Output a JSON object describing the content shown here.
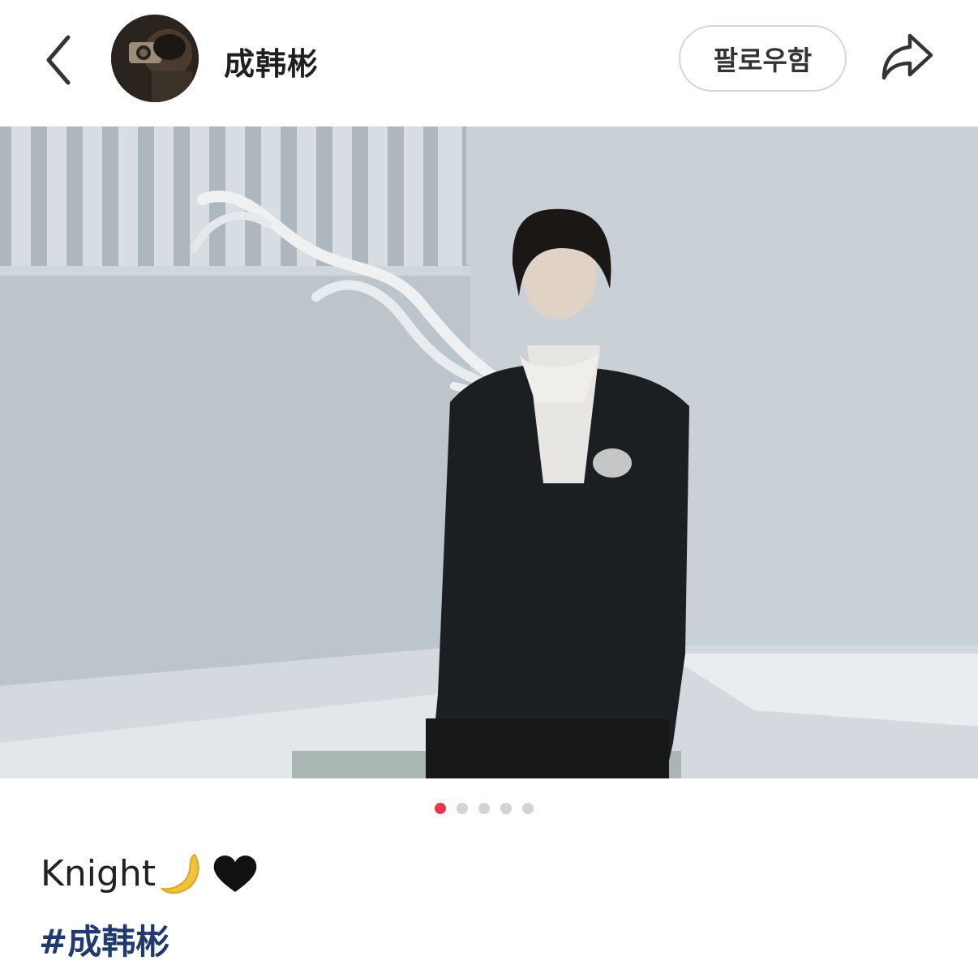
{
  "header": {
    "back_icon": "chevron-left-icon",
    "username": "成韩彬",
    "follow_label": "팔로우함",
    "share_icon": "share-arrow-icon"
  },
  "post": {
    "image_count": 5,
    "active_index": 0,
    "caption_text": "Knight",
    "caption_emojis": [
      "crescent-moon",
      "black-heart"
    ],
    "hashtag": "#成韩彬"
  },
  "colors": {
    "active_dot": "#e8384f",
    "inactive_dot": "#d3d3d3",
    "hashtag": "#1f3a6b"
  }
}
